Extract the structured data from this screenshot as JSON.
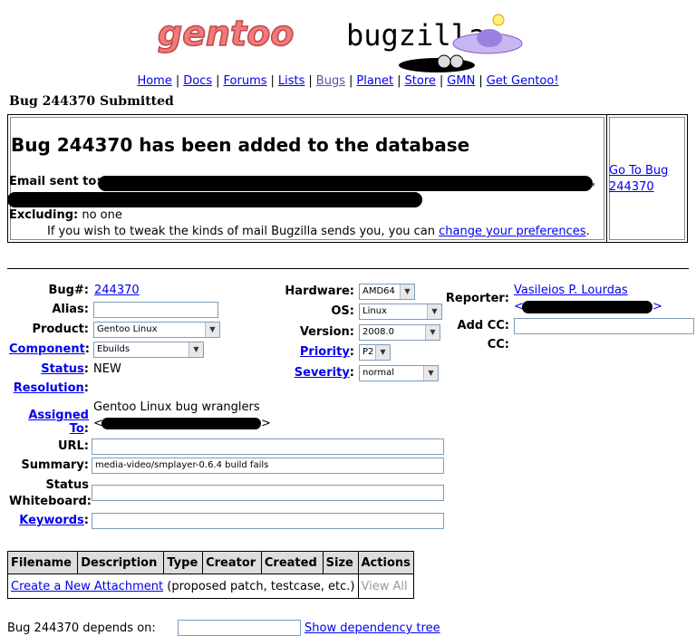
{
  "header": {
    "logo_text_left": "gentoo",
    "logo_text_right": "bugzilla",
    "nav": [
      {
        "label": "Home"
      },
      {
        "label": "Docs"
      },
      {
        "label": "Forums"
      },
      {
        "label": "Lists"
      },
      {
        "label": "Bugs",
        "current": true
      },
      {
        "label": "Planet"
      },
      {
        "label": "Store"
      },
      {
        "label": "GMN"
      },
      {
        "label": "Get Gentoo!"
      }
    ],
    "page_title": "Bug 244370 Submitted"
  },
  "submitted": {
    "heading": "Bug 244370 has been added to the database",
    "email_label": "Email sent to:",
    "email_trailing": ",",
    "excluding_label": "Excluding:",
    "excluding_value": "no one",
    "tweak_text": "If you wish to tweak the kinds of mail Bugzilla sends you, you can",
    "tweak_link": "change your preferences",
    "tweak_end": ".",
    "goto_link": "Go To Bug 244370"
  },
  "fields": {
    "bug_label": "Bug#:",
    "bug_value": "244370",
    "alias_label": "Alias:",
    "alias_value": "",
    "product_label": "Product:",
    "product_value": "Gentoo Linux",
    "component_label": "Component",
    "component_colon": ":",
    "component_value": "Ebuilds",
    "status_label": "Status",
    "status_colon": ":",
    "status_value": "NEW",
    "resolution_label": "Resolution",
    "resolution_colon": ":",
    "assigned_label": "Assigned To",
    "assigned_colon": ":",
    "assigned_value": "Gentoo Linux bug wranglers",
    "assigned_open": "<",
    "assigned_close": ">",
    "hardware_label": "Hardware:",
    "hardware_value": "AMD64",
    "os_label": "OS:",
    "os_value": "Linux",
    "version_label": "Version:",
    "version_value": "2008.0",
    "priority_label": "Priority",
    "priority_colon": ":",
    "priority_value": "P2",
    "severity_label": "Severity",
    "severity_colon": ":",
    "severity_value": "normal",
    "reporter_label": "Reporter:",
    "reporter_name": "Vasileios P. Lourdas",
    "reporter_open": "<",
    "reporter_close": ">",
    "addcc_label": "Add CC:",
    "cc_label": "CC:",
    "url_label": "URL:",
    "url_value": "",
    "summary_label": "Summary:",
    "summary_value": "media-video/smplayer-0.6.4 build fails",
    "whiteboard_label_1": "Status",
    "whiteboard_label_2": "Whiteboard:",
    "whiteboard_value": "",
    "keywords_label": "Keywords",
    "keywords_colon": ":",
    "keywords_value": ""
  },
  "attachments": {
    "headers": [
      "Filename",
      "Description",
      "Type",
      "Creator",
      "Created",
      "Size",
      "Actions"
    ],
    "create_link": "Create a New Attachment",
    "create_hint": "(proposed patch, testcase, etc.)",
    "view_all": "View All"
  },
  "depends": {
    "label": "Bug 244370 depends on:",
    "tree_link": "Show dependency tree"
  }
}
